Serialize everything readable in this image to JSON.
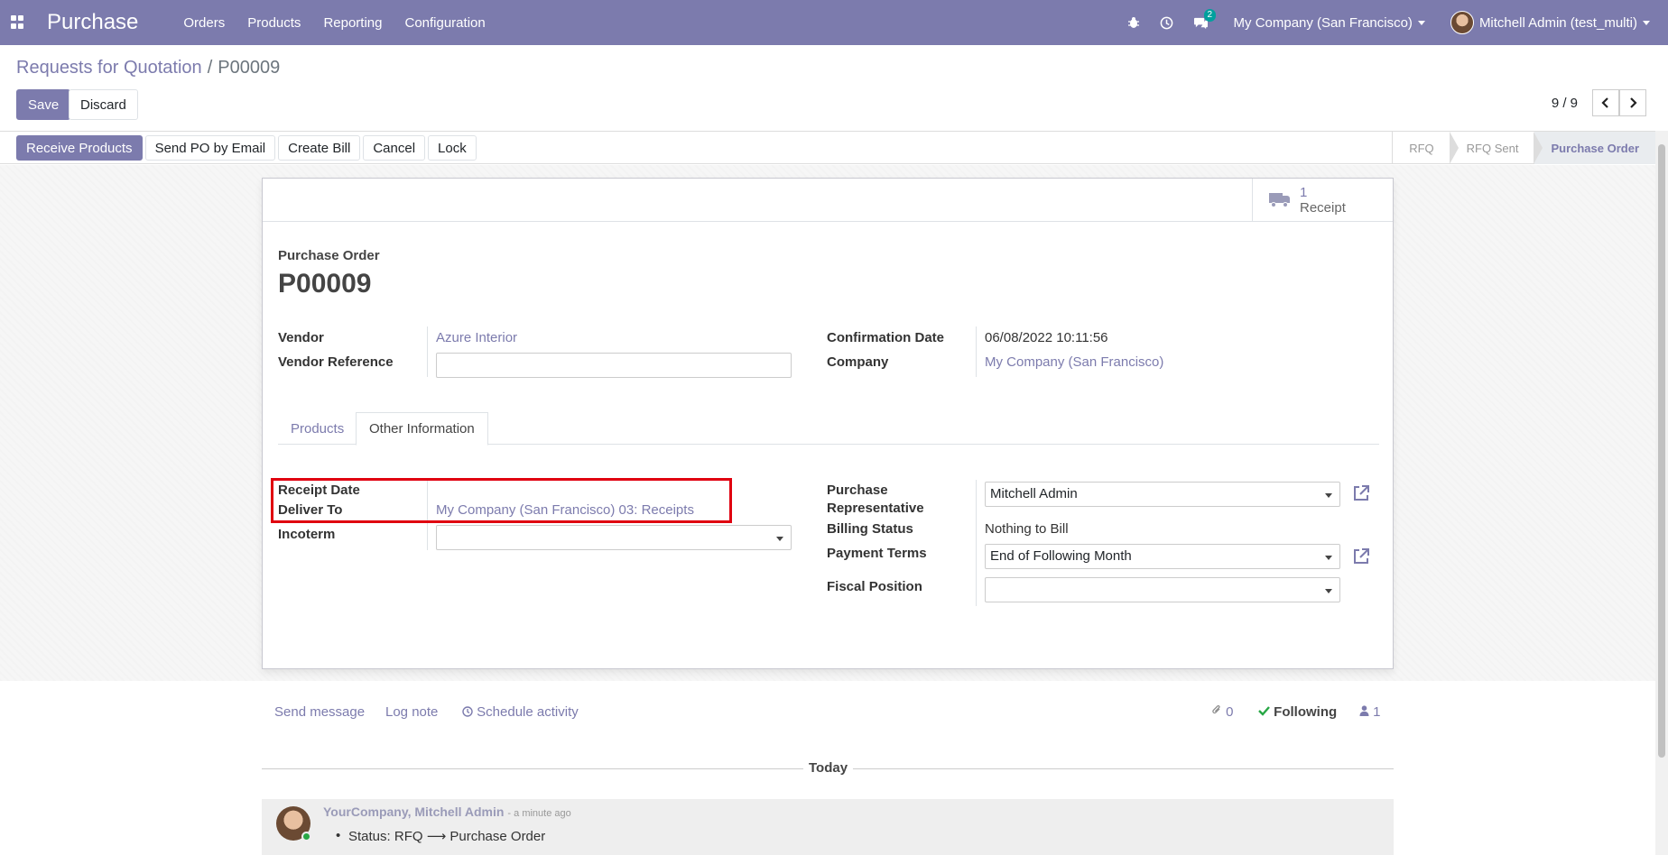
{
  "navbar": {
    "app_name": "Purchase",
    "menu": [
      "Orders",
      "Products",
      "Reporting",
      "Configuration"
    ],
    "chat_count": "2",
    "company": "My Company (San Francisco)",
    "user": "Mitchell Admin (test_multi)"
  },
  "breadcrumb": {
    "parent": "Requests for Quotation",
    "separator": "/",
    "current": "P00009"
  },
  "control": {
    "save": "Save",
    "discard": "Discard",
    "pager": "9 / 9"
  },
  "statusbar": {
    "buttons": [
      "Receive Products",
      "Send PO by Email",
      "Create Bill",
      "Cancel",
      "Lock"
    ],
    "stages": [
      "RFQ",
      "RFQ Sent",
      "Purchase Order"
    ],
    "active_stage": "Purchase Order"
  },
  "smart_button": {
    "count": "1",
    "label": "Receipt"
  },
  "form": {
    "doc_label": "Purchase Order",
    "doc_name": "P00009",
    "vendor_label": "Vendor",
    "vendor_value": "Azure Interior",
    "vendor_ref_label": "Vendor Reference",
    "vendor_ref_value": "",
    "confirmation_label": "Confirmation Date",
    "confirmation_value": "06/08/2022 10:11:56",
    "company_label": "Company",
    "company_value": "My Company (San Francisco)"
  },
  "tabs": [
    "Products",
    "Other Information"
  ],
  "other_info": {
    "receipt_date_label": "Receipt Date",
    "deliver_to_label": "Deliver To",
    "deliver_to_value": "My Company (San Francisco) 03: Receipts",
    "incoterm_label": "Incoterm",
    "incoterm_value": "",
    "purchase_rep_label_1": "Purchase",
    "purchase_rep_label_2": "Representative",
    "purchase_rep_value": "Mitchell Admin",
    "billing_status_label": "Billing Status",
    "billing_status_value": "Nothing to Bill",
    "payment_terms_label": "Payment Terms",
    "payment_terms_value": "End of Following Month",
    "fiscal_position_label": "Fiscal Position",
    "fiscal_position_value": ""
  },
  "chatter": {
    "send_message": "Send message",
    "log_note": "Log note",
    "schedule_activity": "Schedule activity",
    "attachments": "0",
    "following": "Following",
    "followers": "1",
    "today": "Today",
    "message_author": "YourCompany, Mitchell Admin",
    "message_time": "- a minute ago",
    "message_body": "Status: RFQ ⟶ Purchase Order"
  },
  "colors": {
    "brand": "#7c7bad",
    "highlight": "#e0000f",
    "following": "#28a745"
  }
}
